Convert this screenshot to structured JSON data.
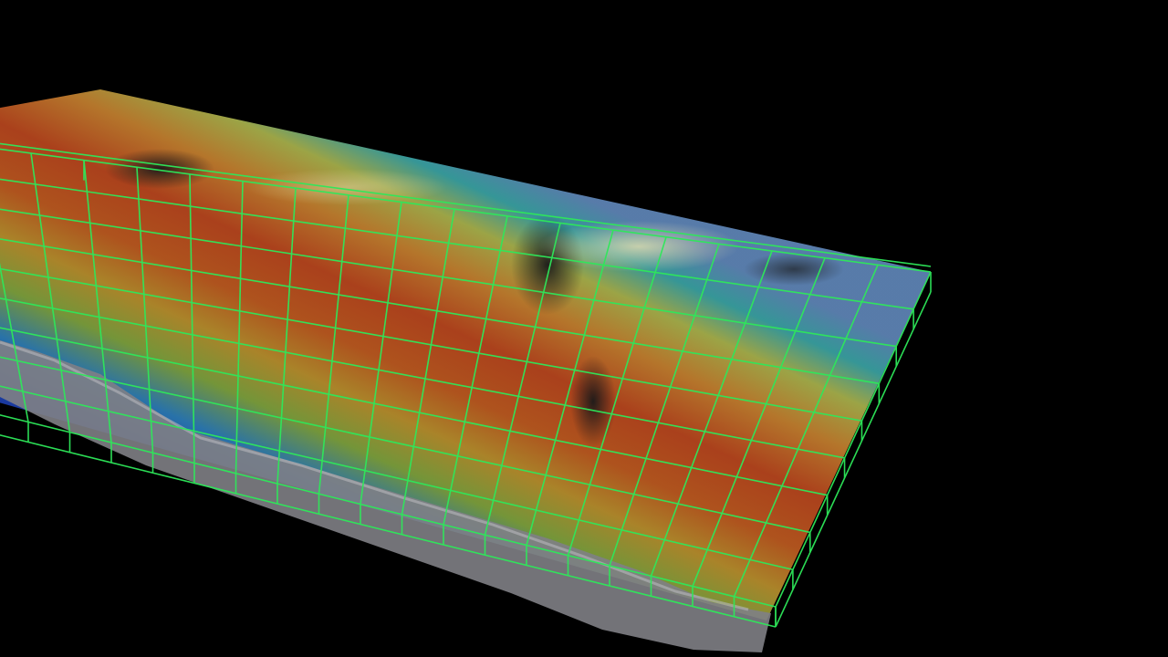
{
  "viewport": {
    "background": "#000000",
    "grid_color": "#2ee85a",
    "surface_gradient": [
      "#5c7fb0",
      "#3aa0a0",
      "#b9b24a",
      "#c9822f",
      "#b8461f",
      "#c0561f",
      "#b88a2c",
      "#8aa23f",
      "#2a7ab8",
      "#1a49b5",
      "#2a2a9a"
    ],
    "terrain_color": "#7d7d80",
    "ice_color": "#9a9aa0"
  }
}
